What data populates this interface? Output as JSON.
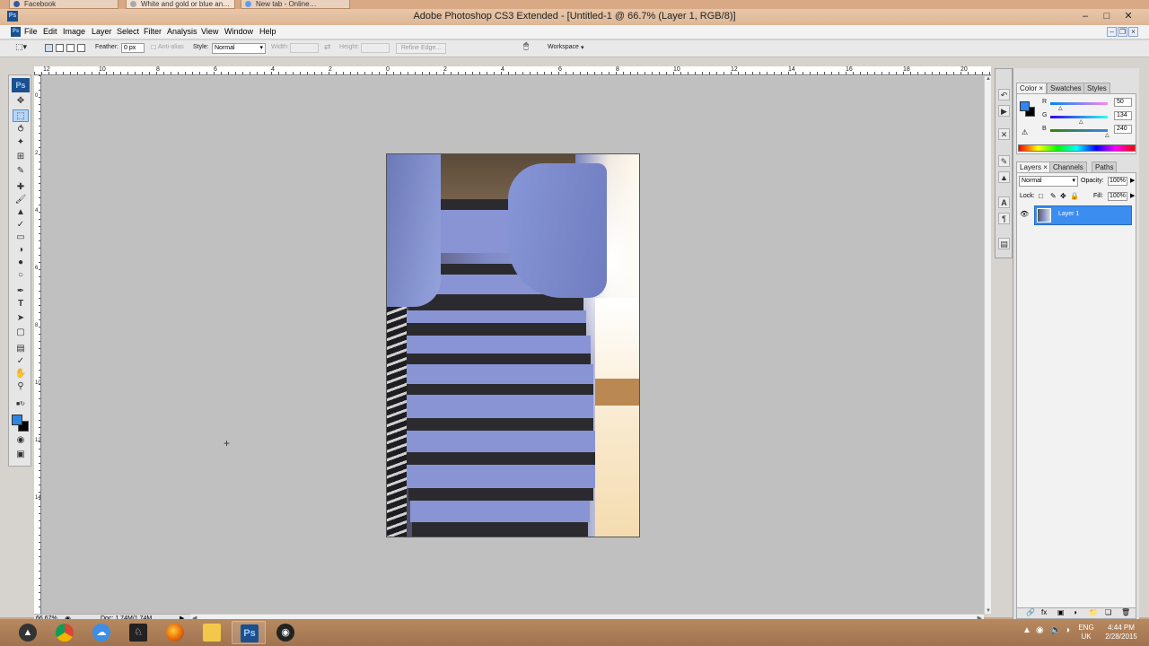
{
  "browser_tabs": [
    "Facebook",
    "White and gold or blue an…",
    "New tab - Online…"
  ],
  "window": {
    "title": "Adobe Photoshop CS3 Extended - [Untitled-1 @ 66.7% (Layer 1, RGB/8)]",
    "logo": "Ps"
  },
  "menu": [
    "File",
    "Edit",
    "Image",
    "Layer",
    "Select",
    "Filter",
    "Analysis",
    "View",
    "Window",
    "Help"
  ],
  "options": {
    "feather_label": "Feather:",
    "feather_value": "0 px",
    "antialias_label": "Anti-alias",
    "style_label": "Style:",
    "style_value": "Normal",
    "width_label": "Width:",
    "height_label": "Height:",
    "refine_edge": "Refine Edge...",
    "workspace": "Workspace"
  },
  "ruler": {
    "top": [
      "12",
      "10",
      "8",
      "6",
      "4",
      "2",
      "0",
      "2",
      "4",
      "6",
      "8",
      "10",
      "12",
      "14",
      "16",
      "18",
      "20"
    ],
    "left": [
      "0",
      "2",
      "4",
      "6",
      "8",
      "10",
      "12",
      "14"
    ]
  },
  "status": {
    "zoom": "66.67%",
    "doc": "Doc: 1.74M/1.74M"
  },
  "color_panel": {
    "tabs": [
      "Color",
      "Swatches",
      "Styles"
    ],
    "r_label": "R",
    "r_value": "50",
    "g_label": "G",
    "g_value": "134",
    "b_label": "B",
    "b_value": "240",
    "colors": {
      "foreground": "#3286f0",
      "background": "#000000"
    }
  },
  "layers_panel": {
    "tabs": [
      "Layers",
      "Channels",
      "Paths"
    ],
    "blend_mode": "Normal",
    "opacity_label": "Opacity:",
    "opacity_value": "100%",
    "lock_label": "Lock:",
    "fill_label": "Fill:",
    "fill_value": "100%",
    "layer_name": "Layer 1"
  },
  "taskbar": {
    "lang": "ENG",
    "region": "UK",
    "time": "4:44 PM",
    "date": "2/28/2015",
    "ps_label": "Ps"
  }
}
